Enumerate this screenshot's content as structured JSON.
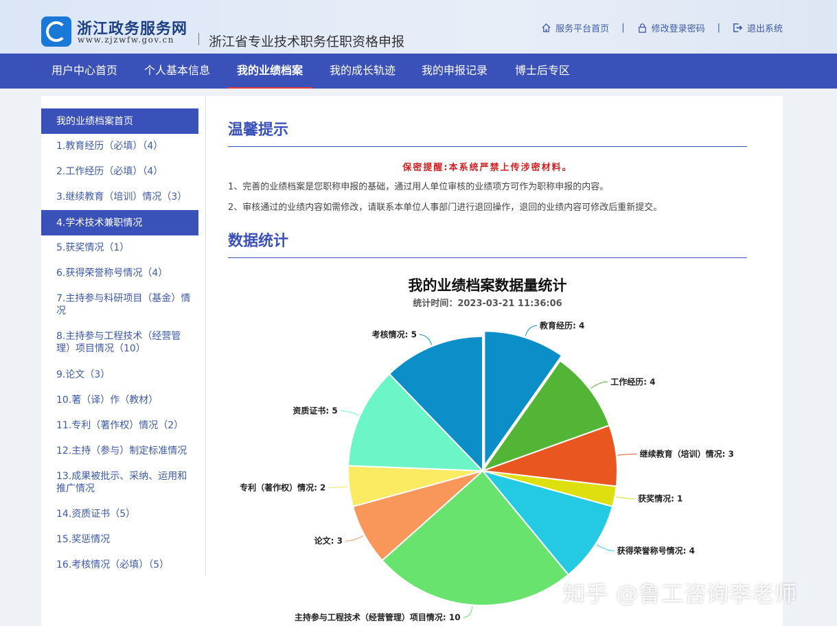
{
  "header": {
    "site_name": "浙江政务服务网",
    "site_url": "www.zjzwfw.gov.cn",
    "system_title": "浙江省专业技术职务任职资格申报",
    "links": [
      {
        "label": "服务平台首页",
        "icon": "home-icon"
      },
      {
        "label": "修改登录密码",
        "icon": "lock-icon"
      },
      {
        "label": "退出系统",
        "icon": "logout-icon"
      }
    ],
    "divider": "|"
  },
  "nav": {
    "items": [
      "用户中心首页",
      "个人基本信息",
      "我的业绩档案",
      "我的成长轨迹",
      "我的申报记录",
      "博士后专区"
    ],
    "active_index": 2
  },
  "sidebar": {
    "items": [
      "我的业绩档案首页",
      "1.教育经历（必填）（4）",
      "2.工作经历（必填）（4）",
      "3.继续教育（培训）情况（3）",
      "4.学术技术兼职情况",
      "5.获奖情况（1）",
      "6.获得荣誉称号情况（4）",
      "7.主持参与科研项目（基金）情况",
      "8.主持参与工程技术（经营管理）项目情况（10）",
      "9.论文（3）",
      "10.著（译）作（教材）",
      "11.专利（著作权）情况（2）",
      "12.主持（参与）制定标准情况",
      "13.成果被批示、采纳、运用和推广情况",
      "14.资质证书（5）",
      "15.奖惩情况",
      "16.考核情况（必填）（5）"
    ],
    "highlighted": [
      0,
      4
    ]
  },
  "notice": {
    "heading": "温馨提示",
    "warning": "保密提醒:本系统严禁上传涉密材料。",
    "tips": [
      "1、完善的业绩档案是您职称申报的基础，通过用人单位审核的业绩项方可作为职称申报的内容。",
      "2、审核通过的业绩内容如需修改，请联系本单位人事部门进行退回操作，退回的业绩内容可修改后重新提交。"
    ]
  },
  "stats": {
    "heading": "数据统计"
  },
  "chart_data": {
    "type": "pie",
    "title": "我的业绩档案数据量统计",
    "subtitle": "统计时间：2023-03-21 11:36:06",
    "slices": [
      {
        "label": "教育经历",
        "value": 4,
        "color": "#0c8ec9",
        "exploded": true
      },
      {
        "label": "工作经历",
        "value": 4,
        "color": "#52b535"
      },
      {
        "label": "继续教育（培训）情况",
        "value": 3,
        "color": "#ea5620"
      },
      {
        "label": "获奖情况",
        "value": 1,
        "color": "#dde00e"
      },
      {
        "label": "获得荣誉称号情况",
        "value": 4,
        "color": "#24c9e3"
      },
      {
        "label": "主持参与工程技术（经营管理）项目情况",
        "value": 10,
        "color": "#68e36e"
      },
      {
        "label": "论文",
        "value": 3,
        "color": "#f9975a"
      },
      {
        "label": "专利（著作权）情况",
        "value": 2,
        "color": "#fbeb62"
      },
      {
        "label": "资质证书",
        "value": 5,
        "color": "#6cf5c6"
      },
      {
        "label": "考核情况",
        "value": 5,
        "color": "#0c8ec9"
      }
    ]
  },
  "watermark": "知乎 @鲁工咨询李老师"
}
